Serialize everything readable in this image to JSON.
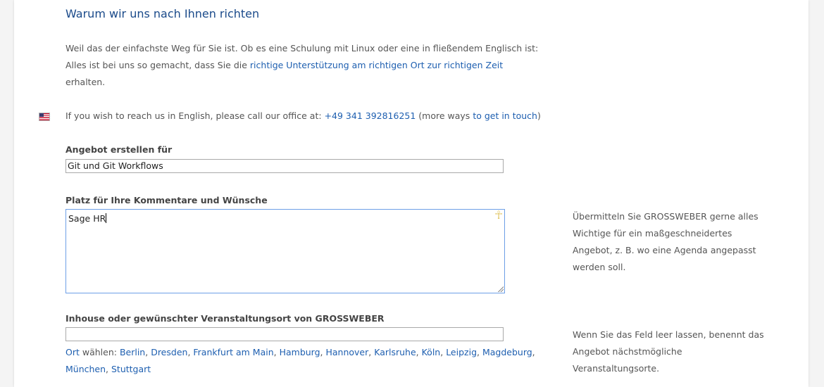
{
  "heading": "Warum wir uns nach Ihnen richten",
  "intro": {
    "line1": "Weil das der einfachste Weg für Sie ist. Ob es eine Schulung mit Linux oder eine in fließendem Englisch ist:",
    "line2_pre": "Alles ist bei uns so gemacht, dass Sie die ",
    "line2_link": "richtige Unterstützung am richtigen Ort zur richtigen Zeit",
    "line3": "erhalten."
  },
  "english": {
    "flag_icon": "us-flag-icon",
    "pre": "If you wish to reach us in English, please call our office at: ",
    "phone": "+49 341 392816251",
    "mid": " (more ways ",
    "link": "to get in touch",
    "post": ")"
  },
  "offer": {
    "label": "Angebot erstellen für",
    "value": "Git und Git Workflows"
  },
  "comments": {
    "label": "Platz für Ihre Kommentare und Wünsche",
    "value": "Sage HR",
    "addon_icon": "ankh-icon",
    "hint": "Übermitteln Sie GROSSWEBER gerne alles Wichtige für ein maßgeschneidertes Angebot, z. B. wo eine Agenda angepasst werden soll."
  },
  "location": {
    "label": "Inhouse oder gewünschter Veranstaltungsort von GROSSWEBER",
    "value": "",
    "hint": "Wenn Sie das Feld leer lassen, benennt das Angebot nächstmögliche Veranstaltungsorte.",
    "choose_link": "Ort",
    "choose_text": " wählen: ",
    "cities_line1": [
      "Berlin",
      "Dresden",
      "Frankfurt am Main",
      "Hamburg",
      "Hannover",
      "Karlsruhe",
      "Köln",
      "Leipzig",
      "Magdeburg"
    ],
    "cities_line2": [
      "München",
      "Stuttgart"
    ]
  },
  "colors": {
    "heading": "#1a4a8a",
    "link": "#1e5fb0",
    "focus_border": "#6d9fe6"
  }
}
